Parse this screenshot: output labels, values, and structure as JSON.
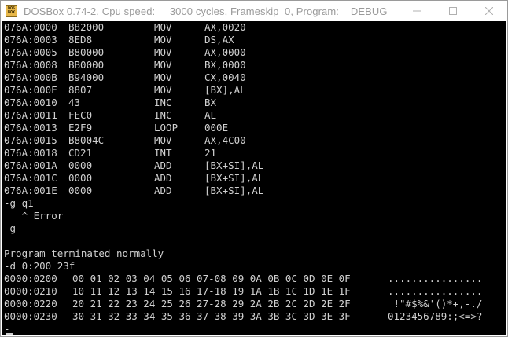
{
  "window": {
    "title": "DOSBox 0.74-2, Cpu speed:     3000 cycles, Frameskip  0, Program:    DEBUG",
    "icon_lines": [
      "DOS",
      "BOX"
    ]
  },
  "disassembly": [
    {
      "addr": "076A:0000",
      "bytes": "B82000",
      "op": "MOV",
      "args": "AX,0020"
    },
    {
      "addr": "076A:0003",
      "bytes": "8ED8",
      "op": "MOV",
      "args": "DS,AX"
    },
    {
      "addr": "076A:0005",
      "bytes": "B80000",
      "op": "MOV",
      "args": "AX,0000"
    },
    {
      "addr": "076A:0008",
      "bytes": "BB0000",
      "op": "MOV",
      "args": "BX,0000"
    },
    {
      "addr": "076A:000B",
      "bytes": "B94000",
      "op": "MOV",
      "args": "CX,0040"
    },
    {
      "addr": "076A:000E",
      "bytes": "8807",
      "op": "MOV",
      "args": "[BX],AL"
    },
    {
      "addr": "076A:0010",
      "bytes": "43",
      "op": "INC",
      "args": "BX"
    },
    {
      "addr": "076A:0011",
      "bytes": "FEC0",
      "op": "INC",
      "args": "AL"
    },
    {
      "addr": "076A:0013",
      "bytes": "E2F9",
      "op": "LOOP",
      "args": "000E"
    },
    {
      "addr": "076A:0015",
      "bytes": "B8004C",
      "op": "MOV",
      "args": "AX,4C00"
    },
    {
      "addr": "076A:0018",
      "bytes": "CD21",
      "op": "INT",
      "args": "21"
    },
    {
      "addr": "076A:001A",
      "bytes": "0000",
      "op": "ADD",
      "args": "[BX+SI],AL"
    },
    {
      "addr": "076A:001C",
      "bytes": "0000",
      "op": "ADD",
      "args": "[BX+SI],AL"
    },
    {
      "addr": "076A:001E",
      "bytes": "0000",
      "op": "ADD",
      "args": "[BX+SI],AL"
    }
  ],
  "console": {
    "cmd1": "-g q1",
    "error": "   ^ Error",
    "cmd2": "-g",
    "blank": "",
    "terminated": "Program terminated normally",
    "cmd3": "-d 0:200 23f"
  },
  "dump": [
    {
      "addr": "0000:0200",
      "hex": "00 01 02 03 04 05 06 07-08 09 0A 0B 0C 0D 0E 0F",
      "ascii": "................"
    },
    {
      "addr": "0000:0210",
      "hex": "10 11 12 13 14 15 16 17-18 19 1A 1B 1C 1D 1E 1F",
      "ascii": "................"
    },
    {
      "addr": "0000:0220",
      "hex": "20 21 22 23 24 25 26 27-28 29 2A 2B 2C 2D 2E 2F",
      "ascii": " !\"#$%&'()*+,-./"
    },
    {
      "addr": "0000:0230",
      "hex": "30 31 32 33 34 35 36 37-38 39 3A 3B 3C 3D 3E 3F",
      "ascii": "0123456789:;<=>?"
    }
  ],
  "prompt": "-"
}
